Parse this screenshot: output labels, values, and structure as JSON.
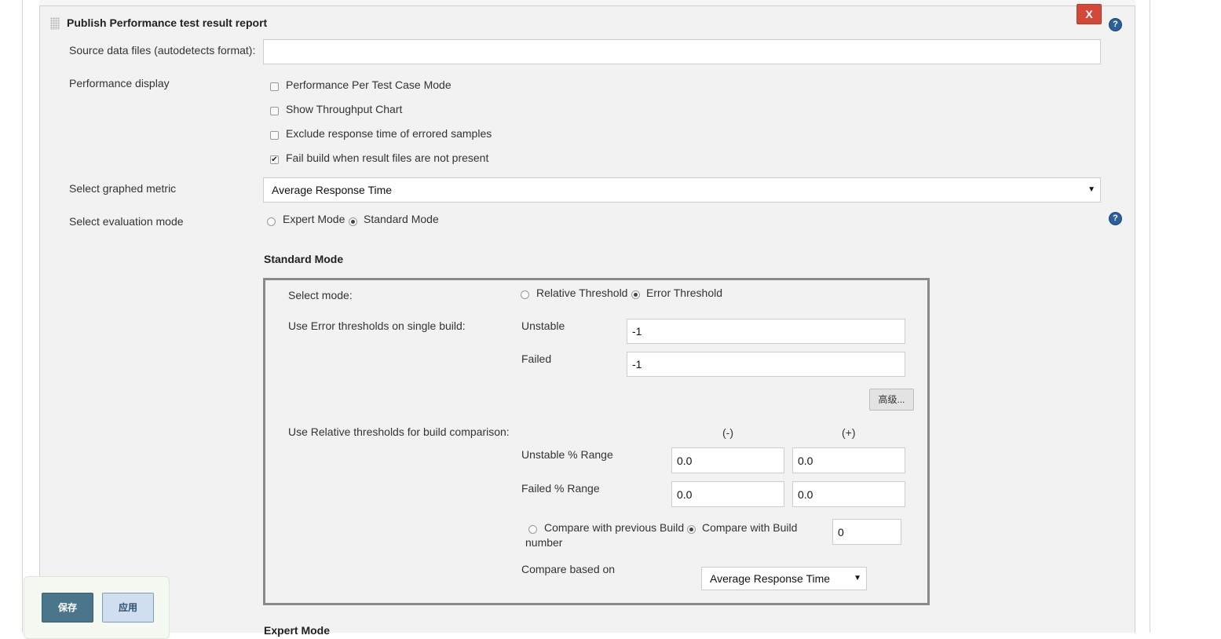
{
  "section": {
    "title": "Publish Performance test result report",
    "close_label": "X",
    "help_label": "?"
  },
  "source_files": {
    "label": "Source data files (autodetects format):",
    "value": ""
  },
  "performance_display": {
    "label": "Performance display",
    "options": [
      {
        "label": "Performance Per Test Case Mode",
        "checked": false
      },
      {
        "label": "Show Throughput Chart",
        "checked": false
      },
      {
        "label": "Exclude response time of errored samples",
        "checked": false
      },
      {
        "label": "Fail build when result files are not present",
        "checked": true
      }
    ]
  },
  "graphed_metric": {
    "label": "Select graphed metric",
    "value": "Average Response Time"
  },
  "evaluation_mode": {
    "label": "Select evaluation mode",
    "option_expert": "Expert Mode",
    "option_standard": "Standard Mode",
    "selected": "Standard Mode"
  },
  "standard_mode": {
    "heading": "Standard Mode",
    "select_mode": {
      "label": "Select mode:",
      "option_relative": "Relative Threshold",
      "option_error": "Error Threshold",
      "selected": "Error Threshold"
    },
    "error_thresholds": {
      "label": "Use Error thresholds on single build:",
      "unstable_label": "Unstable",
      "unstable_value": "-1",
      "failed_label": "Failed",
      "failed_value": "-1"
    },
    "advanced_label": "高级...",
    "relative_thresholds": {
      "label": "Use Relative thresholds for build comparison:",
      "minus_header": "(-)",
      "plus_header": "(+)",
      "unstable_label": "Unstable % Range",
      "unstable_minus": "0.0",
      "unstable_plus": "0.0",
      "failed_label": "Failed % Range",
      "failed_minus": "0.0",
      "failed_plus": "0.0"
    },
    "compare": {
      "option_previous_line1": "Compare with previous Build",
      "option_previous_line2": "number",
      "option_build": "Compare with Build",
      "build_number": "0",
      "based_on_label": "Compare based on",
      "based_on_value": "Average Response Time"
    }
  },
  "expert_mode_heading": "Expert Mode",
  "footer": {
    "save_label": "保存",
    "apply_label": "应用"
  }
}
